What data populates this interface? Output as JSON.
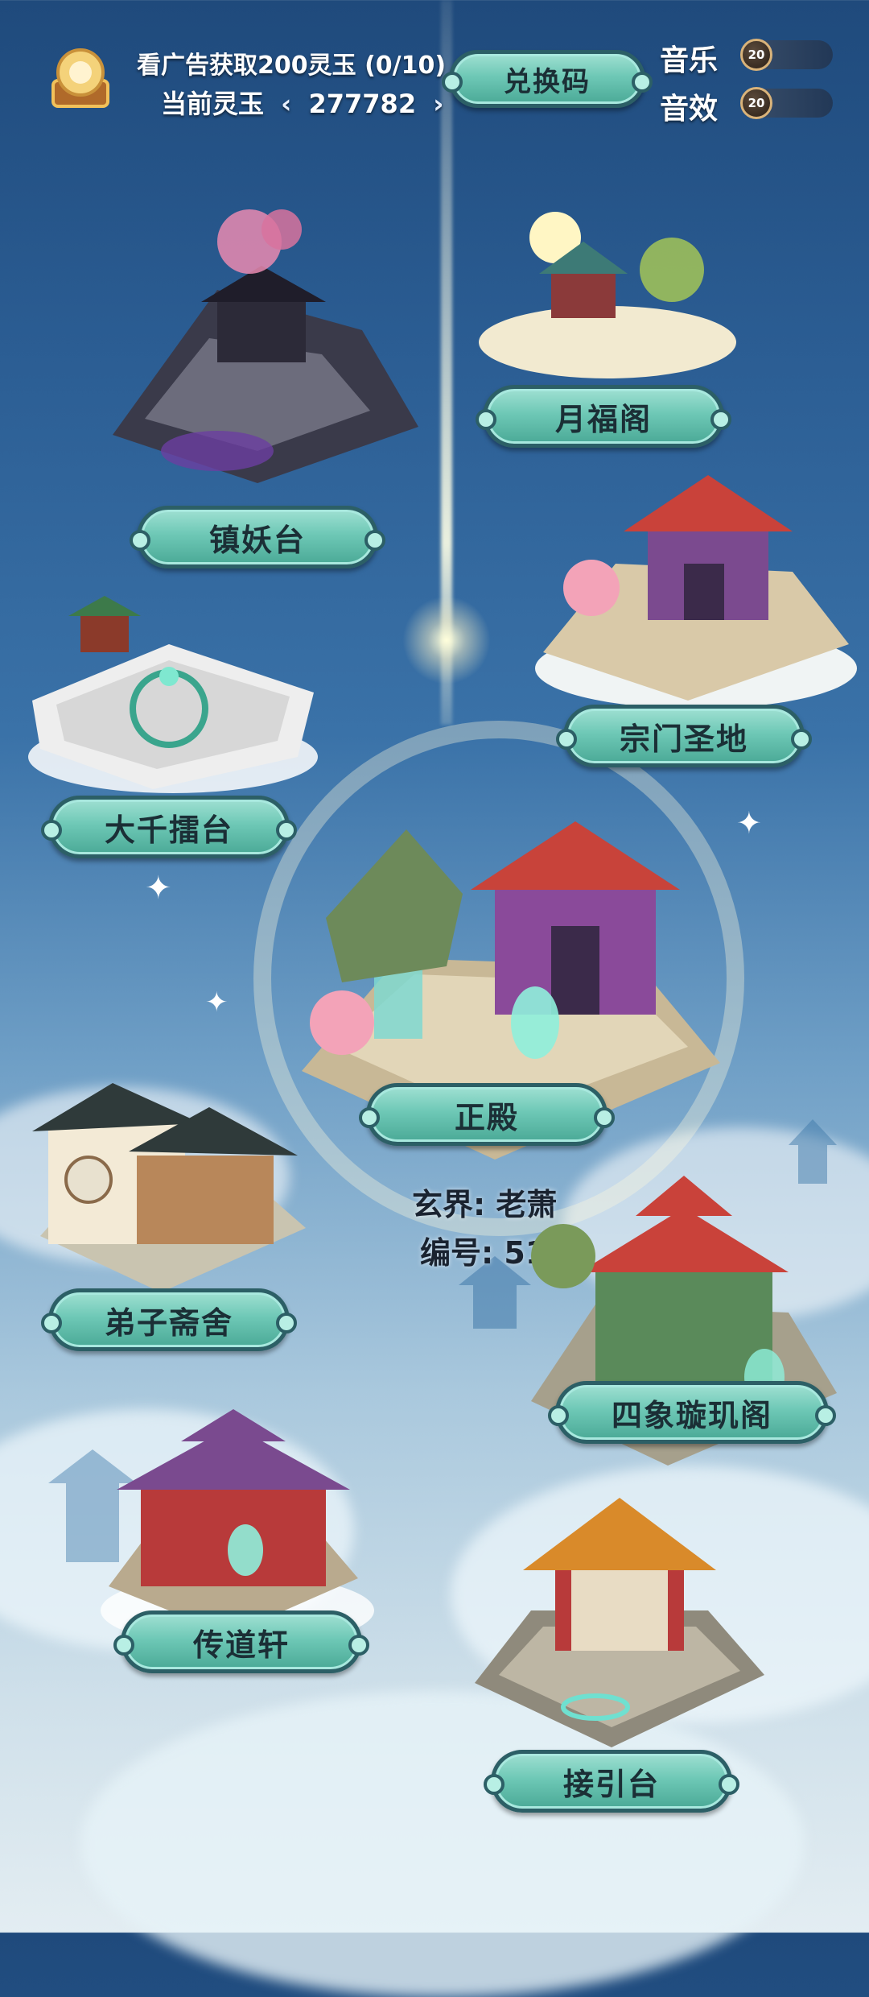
{
  "header": {
    "ad_text": "看广告获取200灵玉 (0/10)",
    "jade_label": "当前灵玉",
    "jade_value": "277782",
    "redeem_label": "兑换码",
    "music_label": "音乐",
    "music_value": "20",
    "sfx_label": "音效",
    "sfx_value": "20"
  },
  "buildings": {
    "zhenyao": "镇妖台",
    "yuefu": "月福阁",
    "zongmen": "宗门圣地",
    "daqian": "大千擂台",
    "zhengdian": "正殿",
    "dizi": "弟子斋舍",
    "sixiang": "四象璇玑阁",
    "chuandao": "传道轩",
    "jieyin": "接引台"
  },
  "realm": {
    "name_label": "玄界: 老萧",
    "id_label": "编号: 517"
  },
  "colors": {
    "button_fill": "#6ec8b6",
    "button_border": "#2c5f66",
    "sky_top": "#1f4a7c"
  }
}
